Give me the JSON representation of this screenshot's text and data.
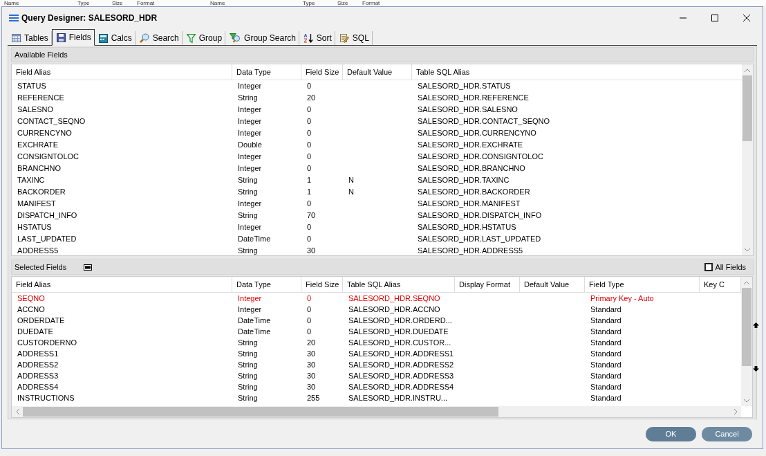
{
  "background_headers": [
    "Name",
    "Type",
    "Size",
    "Format",
    "Name",
    "Type",
    "Size",
    "Format"
  ],
  "window": {
    "title": "Query Designer: SALESORD_HDR"
  },
  "tabs": [
    {
      "label": "Tables",
      "selected": false
    },
    {
      "label": "Fields",
      "selected": true
    },
    {
      "label": "Calcs",
      "selected": false
    },
    {
      "label": "Search",
      "selected": false
    },
    {
      "label": "Group",
      "selected": false
    },
    {
      "label": "Group Search",
      "selected": false
    },
    {
      "label": "Sort",
      "selected": false
    },
    {
      "label": "SQL",
      "selected": false
    }
  ],
  "available_fields": {
    "title": "Available Fields",
    "columns": [
      "Field Alias",
      "Data Type",
      "Field Size",
      "Default Value",
      "Table SQL Alias"
    ],
    "rows": [
      [
        "STATUS",
        "Integer",
        "0",
        "",
        "SALESORD_HDR.STATUS"
      ],
      [
        "REFERENCE",
        "String",
        "20",
        "",
        "SALESORD_HDR.REFERENCE"
      ],
      [
        "SALESNO",
        "Integer",
        "0",
        "",
        "SALESORD_HDR.SALESNO"
      ],
      [
        "CONTACT_SEQNO",
        "Integer",
        "0",
        "",
        "SALESORD_HDR.CONTACT_SEQNO"
      ],
      [
        "CURRENCYNO",
        "Integer",
        "0",
        "",
        "SALESORD_HDR.CURRENCYNO"
      ],
      [
        "EXCHRATE",
        "Double",
        "0",
        "",
        "SALESORD_HDR.EXCHRATE"
      ],
      [
        "CONSIGNTOLOC",
        "Integer",
        "0",
        "",
        "SALESORD_HDR.CONSIGNTOLOC"
      ],
      [
        "BRANCHNO",
        "Integer",
        "0",
        "",
        "SALESORD_HDR.BRANCHNO"
      ],
      [
        "TAXINC",
        "String",
        "1",
        "N",
        "SALESORD_HDR.TAXINC"
      ],
      [
        "BACKORDER",
        "String",
        "1",
        "N",
        "SALESORD_HDR.BACKORDER"
      ],
      [
        "MANIFEST",
        "Integer",
        "0",
        "",
        "SALESORD_HDR.MANIFEST"
      ],
      [
        "DISPATCH_INFO",
        "String",
        "70",
        "",
        "SALESORD_HDR.DISPATCH_INFO"
      ],
      [
        "HSTATUS",
        "Integer",
        "0",
        "",
        "SALESORD_HDR.HSTATUS"
      ],
      [
        "LAST_UPDATED",
        "DateTime",
        "0",
        "",
        "SALESORD_HDR.LAST_UPDATED"
      ],
      [
        "ADDRESS5",
        "String",
        "30",
        "",
        "SALESORD_HDR.ADDRESS5"
      ]
    ]
  },
  "selected_fields": {
    "title": "Selected Fields",
    "all_fields": {
      "label": "All Fields",
      "checked": false
    },
    "columns": [
      "Field Alias",
      "Data Type",
      "Field Size",
      "Table SQL Alias",
      "Display Format",
      "Default Value",
      "Field Type",
      "Key C"
    ],
    "rows": [
      {
        "kind": "primary",
        "cells": [
          "SEQNO",
          "Integer",
          "0",
          "SALESORD_HDR.SEQNO",
          "",
          "",
          "Primary Key - Auto",
          ""
        ]
      },
      {
        "kind": "standard",
        "cells": [
          "ACCNO",
          "Integer",
          "0",
          "SALESORD_HDR.ACCNO",
          "",
          "",
          "Standard",
          ""
        ]
      },
      {
        "kind": "standard",
        "cells": [
          "ORDERDATE",
          "DateTime",
          "0",
          "SALESORD_HDR.ORDERD...",
          "",
          "",
          "Standard",
          ""
        ]
      },
      {
        "kind": "standard",
        "cells": [
          "DUEDATE",
          "DateTime",
          "0",
          "SALESORD_HDR.DUEDATE",
          "",
          "",
          "Standard",
          ""
        ]
      },
      {
        "kind": "standard",
        "cells": [
          "CUSTORDERNO",
          "String",
          "20",
          "SALESORD_HDR.CUSTOR...",
          "",
          "",
          "Standard",
          ""
        ]
      },
      {
        "kind": "standard",
        "cells": [
          "ADDRESS1",
          "String",
          "30",
          "SALESORD_HDR.ADDRESS1",
          "",
          "",
          "Standard",
          ""
        ]
      },
      {
        "kind": "standard",
        "cells": [
          "ADDRESS2",
          "String",
          "30",
          "SALESORD_HDR.ADDRESS2",
          "",
          "",
          "Standard",
          ""
        ]
      },
      {
        "kind": "standard",
        "cells": [
          "ADDRESS3",
          "String",
          "30",
          "SALESORD_HDR.ADDRESS3",
          "",
          "",
          "Standard",
          ""
        ]
      },
      {
        "kind": "standard",
        "cells": [
          "ADDRESS4",
          "String",
          "30",
          "SALESORD_HDR.ADDRESS4",
          "",
          "",
          "Standard",
          ""
        ]
      },
      {
        "kind": "standard",
        "cells": [
          "INSTRUCTIONS",
          "String",
          "255",
          "SALESORD_HDR.INSTRU...",
          "",
          "",
          "Standard",
          ""
        ]
      }
    ]
  },
  "buttons": [
    "OK",
    "Cancel"
  ]
}
